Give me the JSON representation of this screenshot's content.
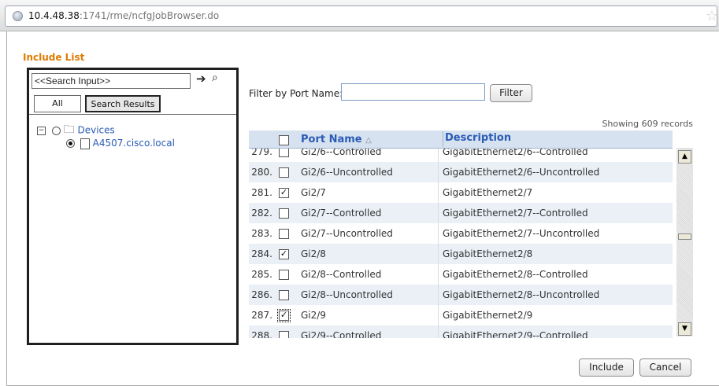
{
  "browser": {
    "url_host": "10.4.48.38",
    "url_rest": ":1741/rme/ncfgJobBrowser.do"
  },
  "include_list": {
    "title": "Include List",
    "search_input_value": "<<Search Input>>",
    "tabs": [
      {
        "label": "All"
      },
      {
        "label": "Search Results"
      }
    ],
    "tree": {
      "root_expander": "⊟",
      "root_label": "Devices",
      "child_label": "A4507.cisco.local"
    }
  },
  "filter": {
    "label": "Filter by Port Name:",
    "value": "",
    "button_label": "Filter"
  },
  "grid": {
    "record_count": "Showing 609 records",
    "columns": {
      "port_name": "Port Name",
      "sort_indicator": "△",
      "description": "Description"
    },
    "rows": [
      {
        "num": "279.",
        "checked": false,
        "port": "Gi2/6--Controlled",
        "desc": "GigabitEthernet2/6--Controlled"
      },
      {
        "num": "280.",
        "checked": false,
        "port": "Gi2/6--Uncontrolled",
        "desc": "GigabitEthernet2/6--Uncontrolled"
      },
      {
        "num": "281.",
        "checked": true,
        "port": "Gi2/7",
        "desc": "GigabitEthernet2/7"
      },
      {
        "num": "282.",
        "checked": false,
        "port": "Gi2/7--Controlled",
        "desc": "GigabitEthernet2/7--Controlled"
      },
      {
        "num": "283.",
        "checked": false,
        "port": "Gi2/7--Uncontrolled",
        "desc": "GigabitEthernet2/7--Uncontrolled"
      },
      {
        "num": "284.",
        "checked": true,
        "port": "Gi2/8",
        "desc": "GigabitEthernet2/8"
      },
      {
        "num": "285.",
        "checked": false,
        "port": "Gi2/8--Controlled",
        "desc": "GigabitEthernet2/8--Controlled"
      },
      {
        "num": "286.",
        "checked": false,
        "port": "Gi2/8--Uncontrolled",
        "desc": "GigabitEthernet2/8--Uncontrolled"
      },
      {
        "num": "287.",
        "checked": true,
        "focused": true,
        "port": "Gi2/9",
        "desc": "GigabitEthernet2/9"
      },
      {
        "num": "288.",
        "checked": false,
        "port": "Gi2/9--Controlled",
        "desc": "GigabitEthernet2/9--Controlled"
      }
    ]
  },
  "actions": {
    "include_label": "Include",
    "cancel_label": "Cancel"
  },
  "colors": {
    "title_orange": "#e07b00",
    "link_blue": "#2a5bb6",
    "header_bg": "#d6e2ef",
    "alt_row_bg": "#eaf0f6"
  }
}
